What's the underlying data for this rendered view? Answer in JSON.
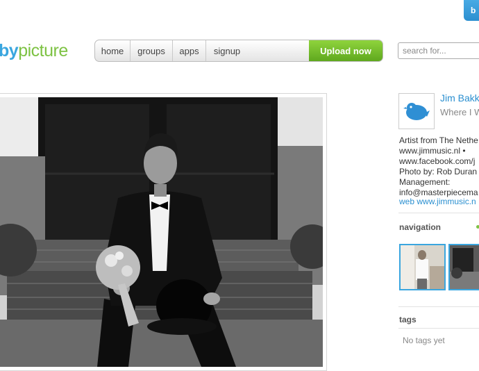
{
  "header": {
    "corner_button_label": "b",
    "logo_part1": "by",
    "logo_part2": "picture",
    "nav": {
      "home": "home",
      "groups": "groups",
      "apps": "apps",
      "signup": "signup",
      "upload": "Upload now"
    },
    "search_placeholder": "search for..."
  },
  "sidebar": {
    "user_name": "Jim Bakk",
    "user_subtitle": "Where I W",
    "bio_lines": [
      "Artist from The Nethe",
      "www.jimmusic.nl •",
      "www.facebook.com/j",
      "Photo by: Rob Duran",
      "Management:",
      "info@masterpiecema"
    ],
    "web_label": "web",
    "web_url": "www.jimmusic.n",
    "navigation_title": "navigation",
    "tags_title": "tags",
    "tags_empty": "No tags yet"
  },
  "colors": {
    "brand_blue": "#3aa6df",
    "brand_green": "#7dc243",
    "upload_green": "#6cb82a"
  }
}
